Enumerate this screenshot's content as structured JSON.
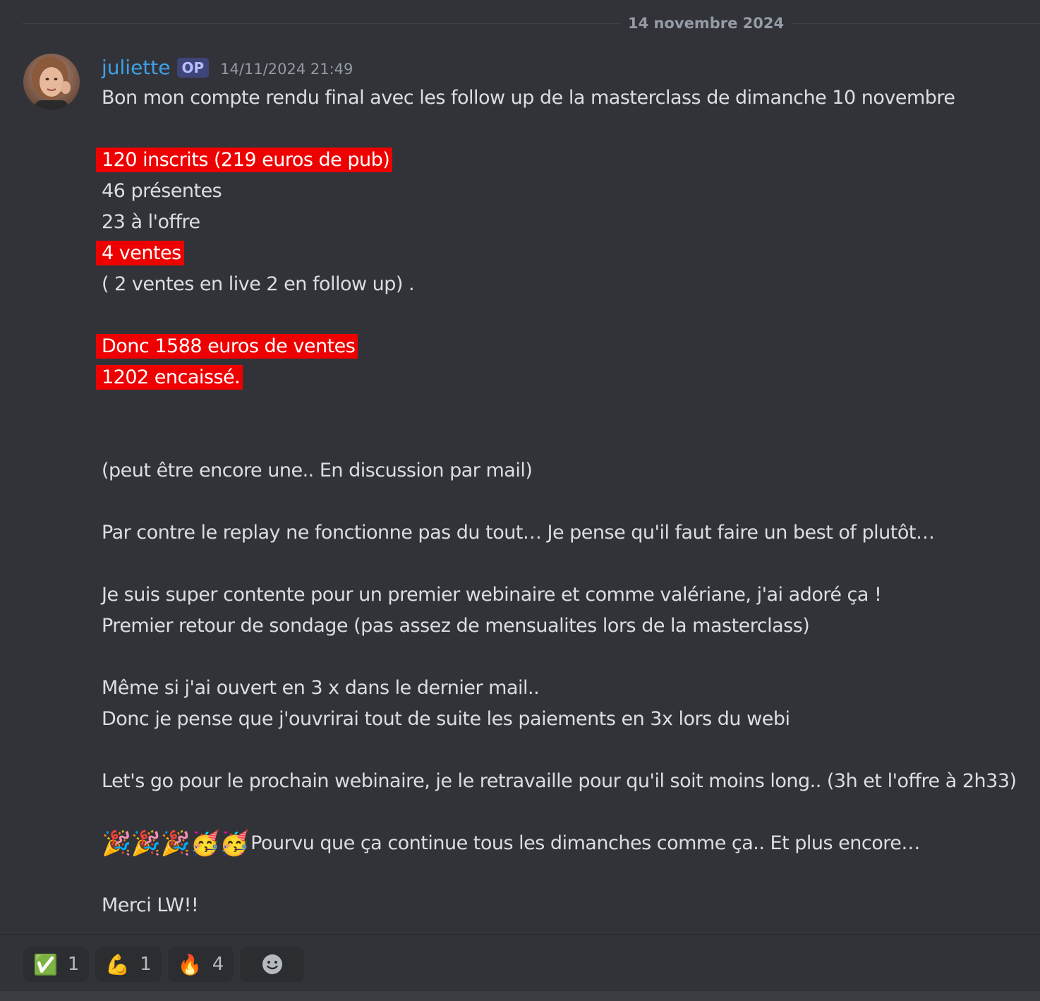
{
  "date_divider": "14 novembre 2024",
  "message": {
    "username": "juliette",
    "badge": "OP",
    "timestamp": "14/11/2024 21:49",
    "lines": {
      "l1": "Bon mon compte rendu final avec les follow up de la masterclass de dimanche 10 novembre",
      "l2": "120 inscrits (219 euros de pub)",
      "l3": "46 présentes",
      "l4": "23 à l'offre",
      "l5": "4 ventes",
      "l6": "( 2 ventes en live 2 en follow up) .",
      "l7": "Donc 1588 euros de ventes",
      "l8": "1202 encaissé.",
      "l9": "(peut être encore une.. En discussion par mail)",
      "l10": "Par contre le replay ne fonctionne pas du tout… Je pense qu'il faut faire un best of plutôt…",
      "l11": "Je suis super  contente pour un premier webinaire et comme valériane, j'ai adoré ça !",
      "l12": "Premier retour de sondage (pas assez de mensualites lors de la masterclass)",
      "l13": "Même si j'ai ouvert en 3 x dans le dernier mail..",
      "l14": "Donc je pense que j'ouvrirai tout de suite les paiements en 3x lors du webi",
      "l15": "Let's go pour le prochain webinaire, je le retravaille pour qu'il soit moins long.. (3h et l'offre à 2h33)",
      "l16_emojis": "🎉🎉🎉🥳🥳",
      "l16_text": "Pourvu que ça continue tous les dimanches comme ça.. Et plus encore…",
      "l17": "Merci LW!!"
    },
    "highlight_color": "#ee0000",
    "username_color": "#3ea1e8"
  },
  "reactions": [
    {
      "emoji": "✅",
      "icon_name": "check-mark-icon",
      "count": "1"
    },
    {
      "emoji": "💪",
      "icon_name": "flexed-biceps-icon",
      "count": "1"
    },
    {
      "emoji": "🔥",
      "icon_name": "fire-icon",
      "count": "4"
    }
  ],
  "add_reaction_icon": "smiley-add-reaction-icon"
}
